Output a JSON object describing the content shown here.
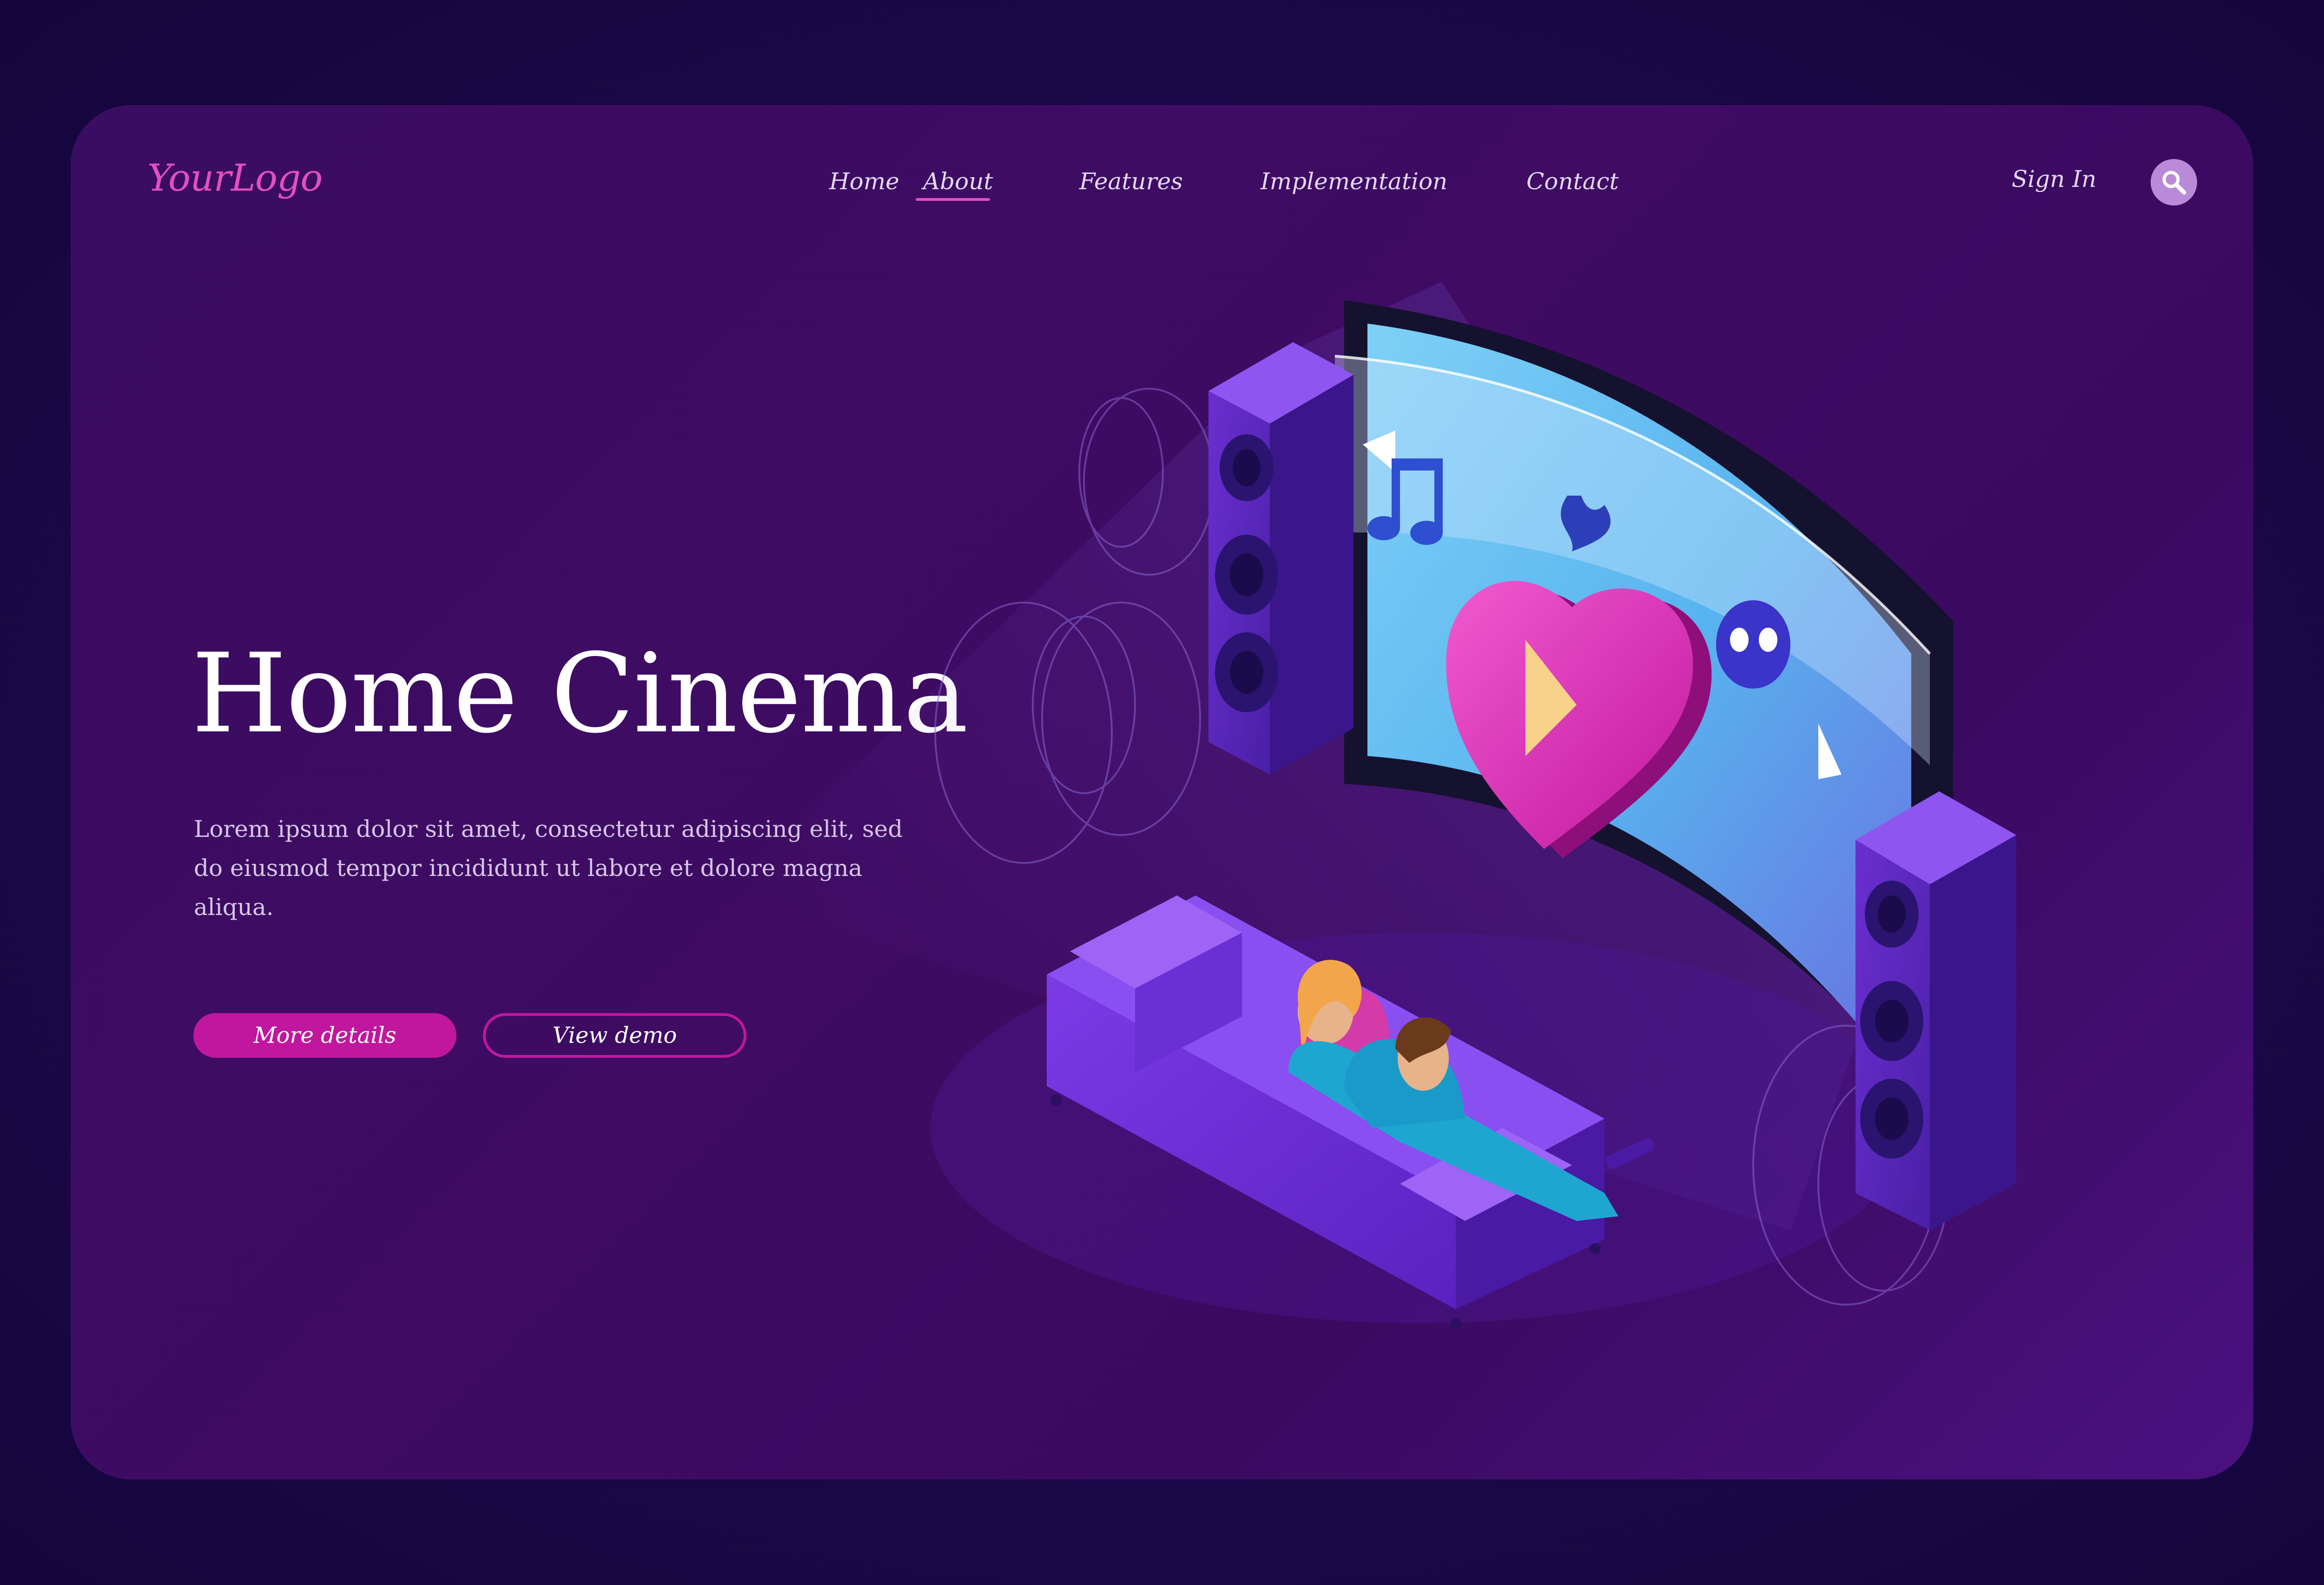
{
  "header": {
    "logo": "YourLogo",
    "nav": [
      {
        "label": "Home",
        "active": false
      },
      {
        "label": "About",
        "active": true
      },
      {
        "label": "Features",
        "active": false
      },
      {
        "label": "Implementation",
        "active": false
      },
      {
        "label": "Contact",
        "active": false
      }
    ],
    "signin_label": "Sign In",
    "search_icon": "search-icon"
  },
  "hero": {
    "title": "Home Cinema",
    "description": "Lorem ipsum dolor sit amet, consectetur adipiscing elit, sed do eiusmod tempor incididunt ut labore et dolore magna aliqua.",
    "primary_button": "More details",
    "secondary_button": "View demo"
  },
  "illustration": {
    "screen_icons": [
      "music-note-icon",
      "heart-play-icon",
      "fire-icon",
      "skull-icon",
      "arrow-left-icon",
      "arrow-right-icon"
    ],
    "elements": [
      "curved-screen",
      "left-speaker",
      "right-speaker",
      "sofa",
      "couple-viewers",
      "remote-control"
    ]
  },
  "colors": {
    "background": "#1a0848",
    "card": "#3f0b63",
    "accent": "#c0179e",
    "logo": "#e24fc0",
    "text": "#ffffff",
    "muted_text": "#d6c6ea"
  }
}
